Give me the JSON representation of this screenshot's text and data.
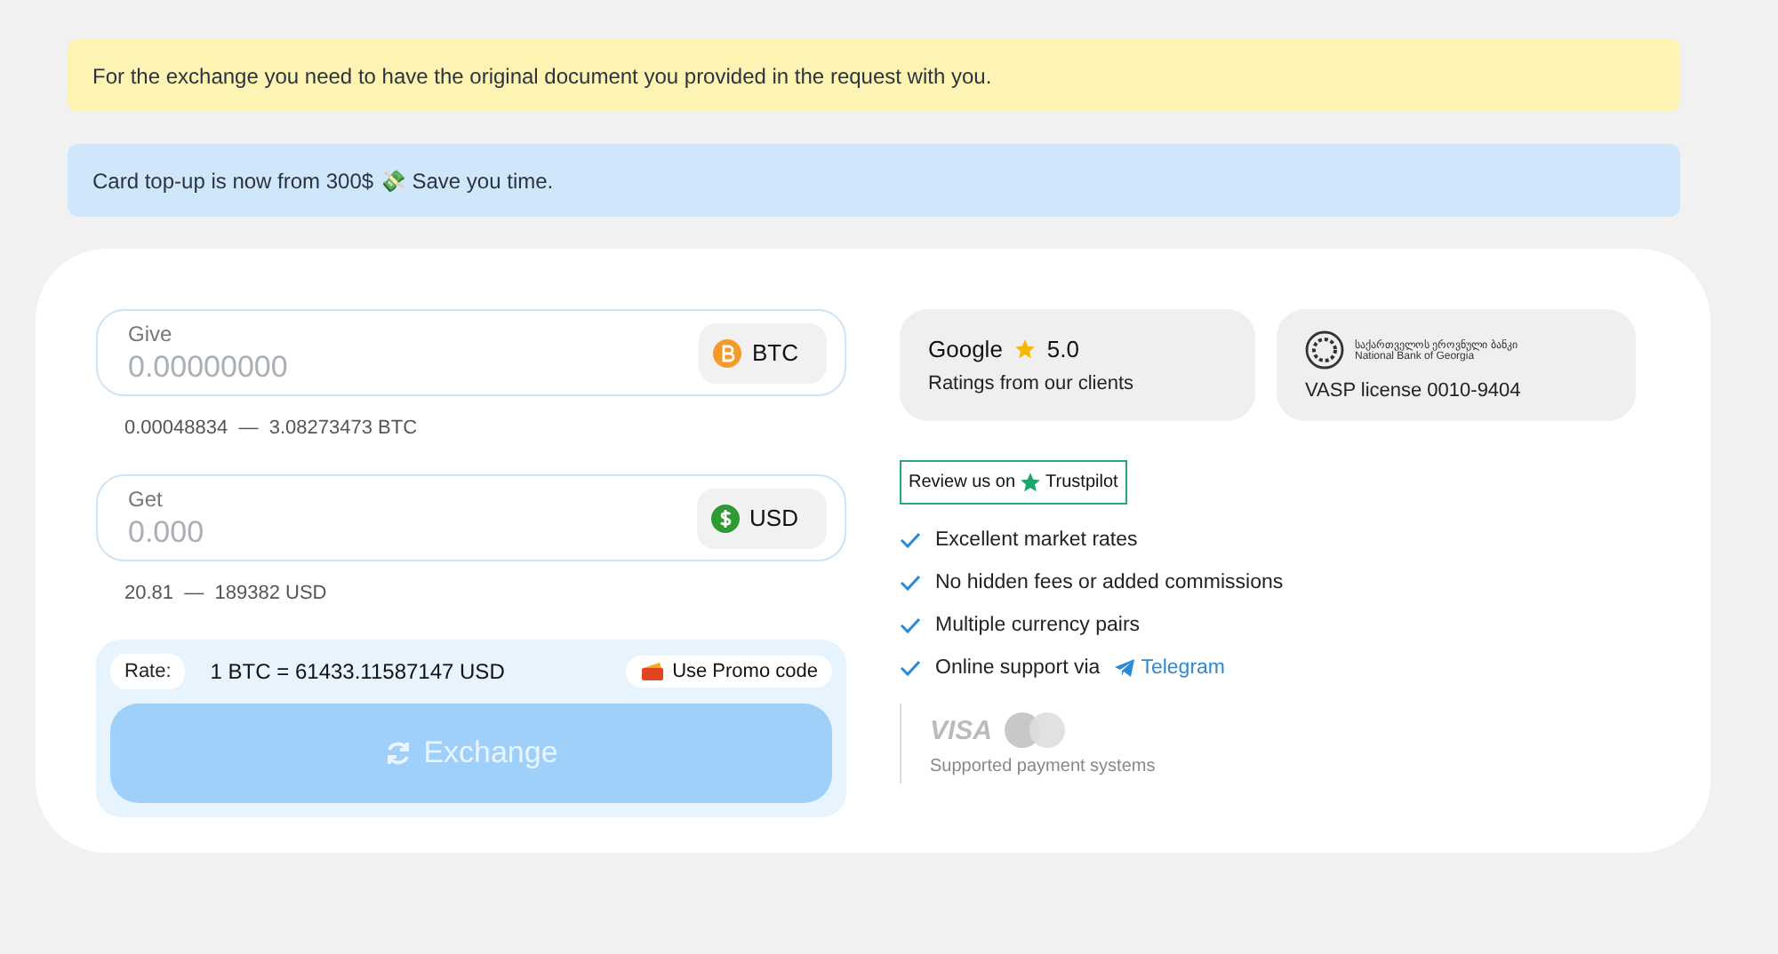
{
  "notices": [
    {
      "kind": "warning",
      "text": "For the exchange you need to have the original document you provided in the request with you."
    },
    {
      "kind": "info",
      "text": "Card top-up is now from 300$ 💸 Save you time."
    }
  ],
  "exchange": {
    "fields": [
      {
        "label": "Give",
        "placeholder": "0.00000000",
        "currency": "BTC",
        "kind": "bitcoin",
        "range": "0.00048834  —  3.08273473 BTC"
      },
      {
        "label": "Get",
        "placeholder": "0.000",
        "currency": "USD",
        "kind": "dollar",
        "range": "20.81  —  189382 USD"
      }
    ],
    "rate_label": "Rate:",
    "rate": "1 BTC = 61433.11587147 USD",
    "promo": "Use Promo code",
    "button": {
      "label": "Exchange",
      "disabled": true
    }
  },
  "google": {
    "name": "Google",
    "score": "5.0",
    "caption": "Ratings from our clients"
  },
  "license": {
    "bank_ka": "საქართველოს ეროვნული ბანკი",
    "bank_en": "National Bank of Georgia",
    "text": "VASP license 0010-9404"
  },
  "trustpilot": {
    "prefix": "Review us on",
    "name": "Trustpilot"
  },
  "features": [
    {
      "text": "Excellent market rates"
    },
    {
      "text": "No hidden fees or added commissions"
    },
    {
      "text": "Multiple currency pairs"
    },
    {
      "text": "Online support via",
      "link": "Telegram"
    }
  ],
  "payments": {
    "visa": "VISA",
    "caption": "Supported payment systems"
  }
}
